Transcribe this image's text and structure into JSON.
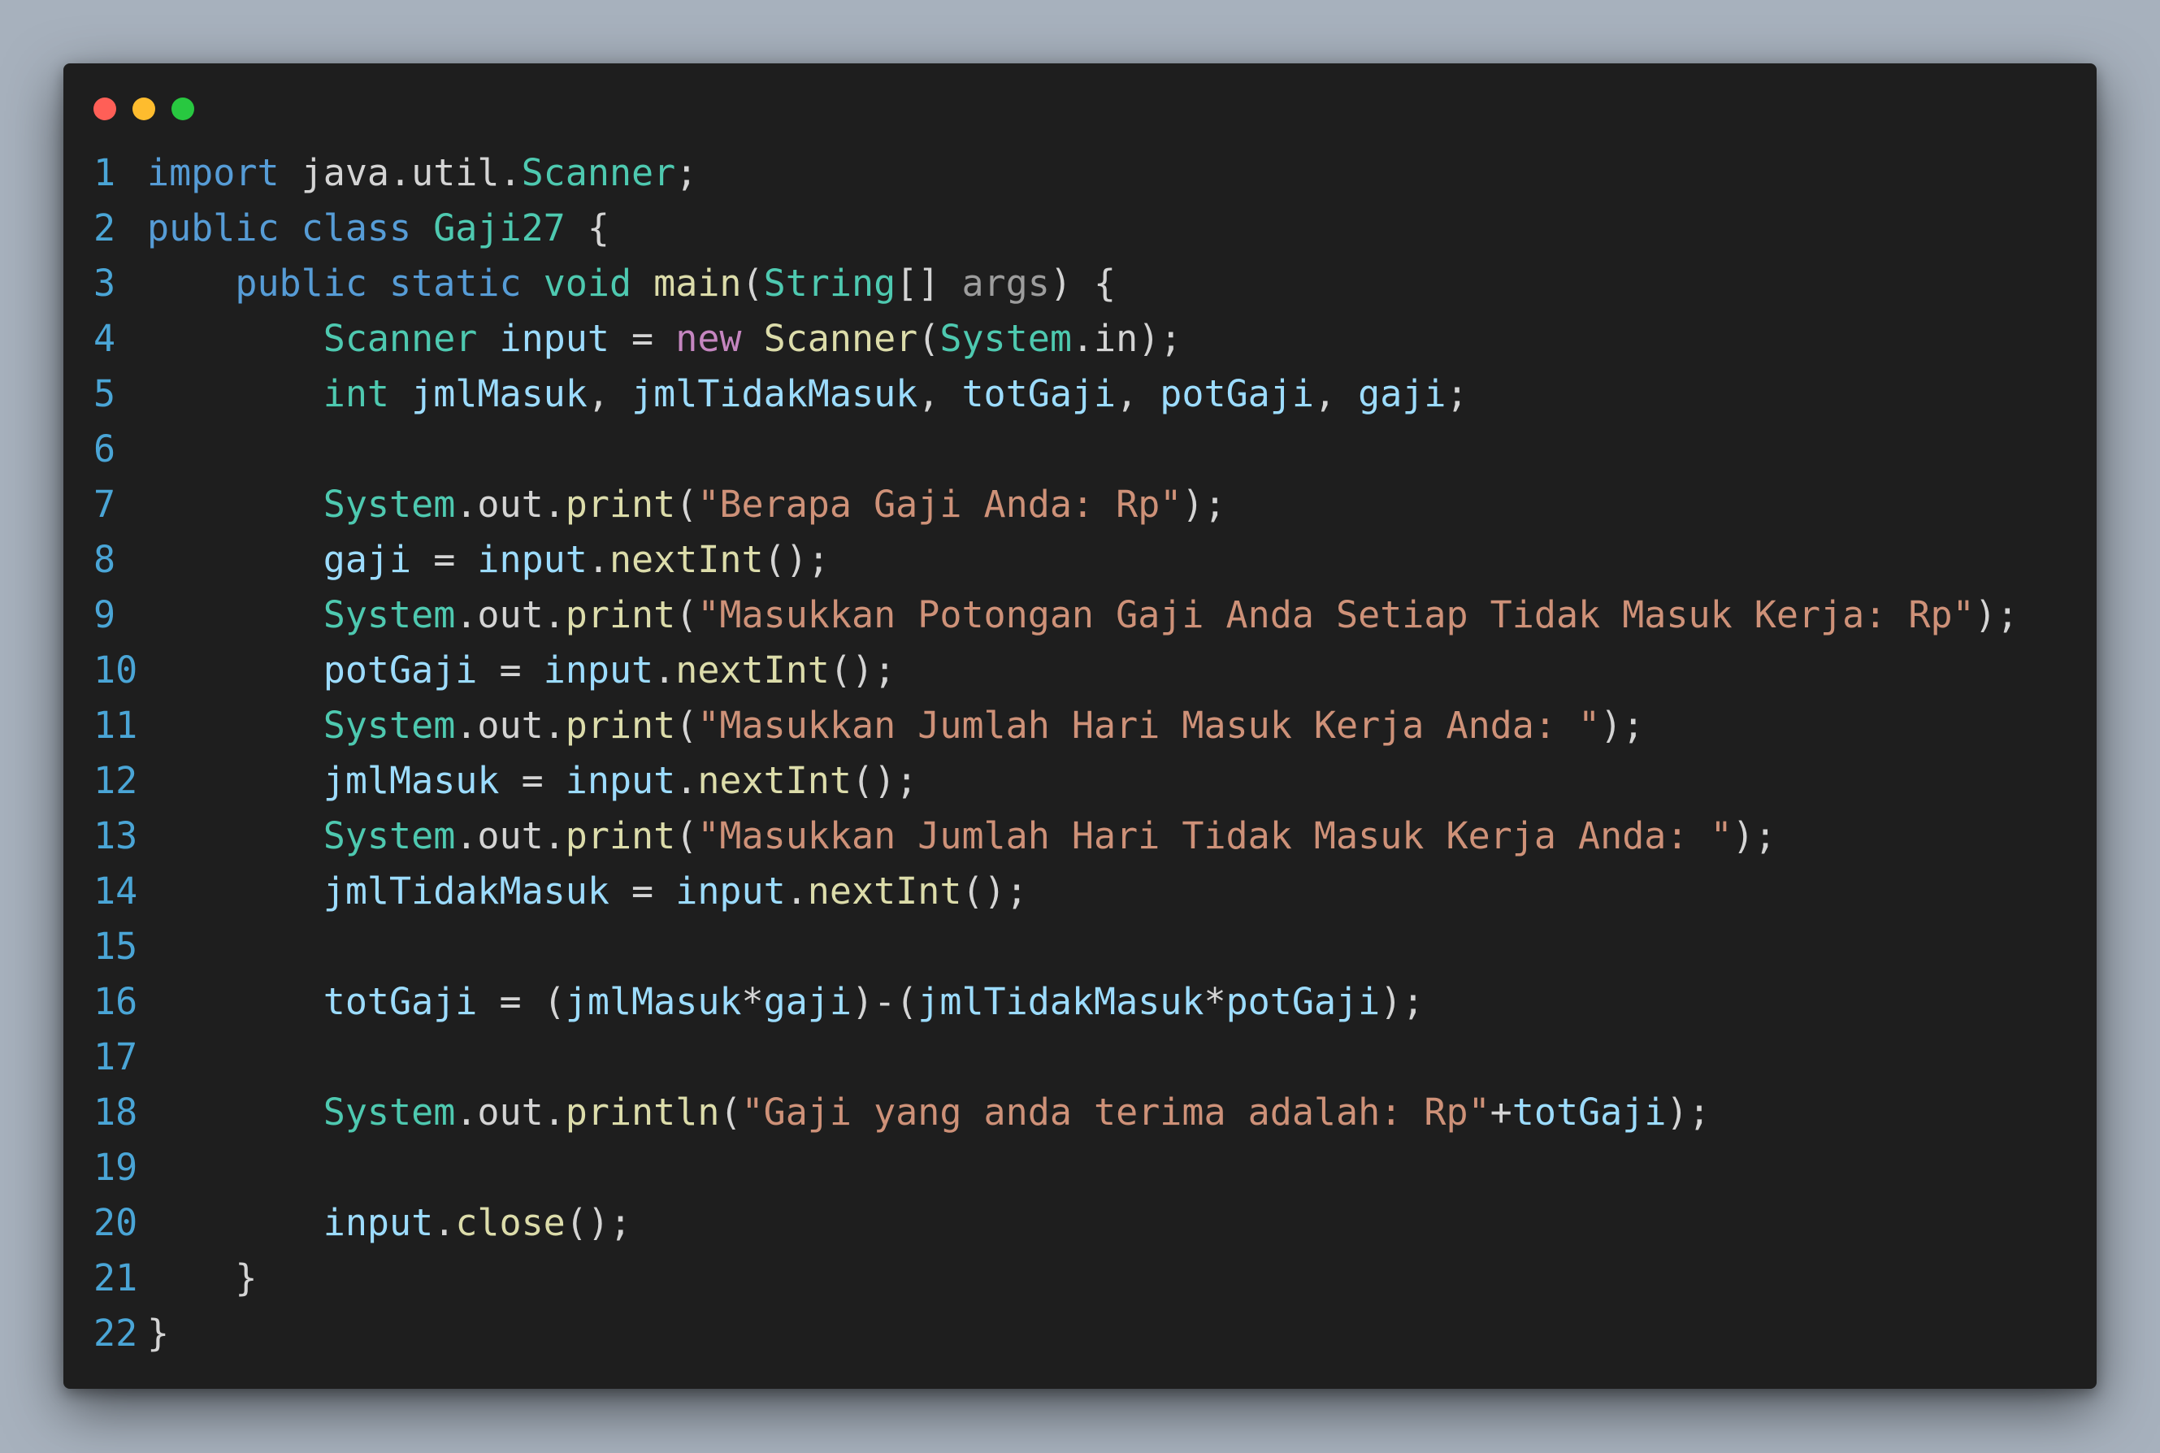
{
  "window": {
    "buttons": [
      {
        "name": "close",
        "color": "#ff5f57"
      },
      {
        "name": "minimize",
        "color": "#febc2e"
      },
      {
        "name": "maximize",
        "color": "#28c840"
      }
    ]
  },
  "colors": {
    "background": "#a7b1bd",
    "editor_bg": "#1e1e1e",
    "line_number": "#4aa5d6",
    "keyword": "#569cd6",
    "type": "#4ec9b0",
    "function": "#dcdcaa",
    "variable": "#9cdcfe",
    "string": "#ce9178",
    "new_keyword": "#c586c0",
    "plain": "#d4d4d4"
  },
  "code": {
    "language": "java",
    "lines": [
      {
        "n": "1",
        "indent": "",
        "tokens": [
          {
            "t": "import",
            "c": "kw"
          },
          {
            "t": " java.util.",
            "c": "pl"
          },
          {
            "t": "Scanner",
            "c": "ty"
          },
          {
            "t": ";",
            "c": "pl"
          }
        ]
      },
      {
        "n": "2",
        "indent": "",
        "tokens": [
          {
            "t": "public",
            "c": "kw"
          },
          {
            "t": " ",
            "c": "pl"
          },
          {
            "t": "class",
            "c": "kw"
          },
          {
            "t": " ",
            "c": "pl"
          },
          {
            "t": "Gaji27",
            "c": "ty"
          },
          {
            "t": " {",
            "c": "pl"
          }
        ]
      },
      {
        "n": "3",
        "indent": "    ",
        "tokens": [
          {
            "t": "public",
            "c": "kw"
          },
          {
            "t": " ",
            "c": "pl"
          },
          {
            "t": "static",
            "c": "kw"
          },
          {
            "t": " ",
            "c": "pl"
          },
          {
            "t": "void",
            "c": "ty"
          },
          {
            "t": " ",
            "c": "pl"
          },
          {
            "t": "main",
            "c": "fn"
          },
          {
            "t": "(",
            "c": "pl"
          },
          {
            "t": "String",
            "c": "ty"
          },
          {
            "t": "[] ",
            "c": "pl"
          },
          {
            "t": "args",
            "c": "pm"
          },
          {
            "t": ") {",
            "c": "pl"
          }
        ]
      },
      {
        "n": "4",
        "indent": "        ",
        "tokens": [
          {
            "t": "Scanner",
            "c": "ty"
          },
          {
            "t": " ",
            "c": "pl"
          },
          {
            "t": "input",
            "c": "vr"
          },
          {
            "t": " = ",
            "c": "pl"
          },
          {
            "t": "new",
            "c": "nw"
          },
          {
            "t": " ",
            "c": "pl"
          },
          {
            "t": "Scanner",
            "c": "fn"
          },
          {
            "t": "(",
            "c": "pl"
          },
          {
            "t": "System",
            "c": "ty"
          },
          {
            "t": ".in);",
            "c": "pl"
          }
        ]
      },
      {
        "n": "5",
        "indent": "        ",
        "tokens": [
          {
            "t": "int",
            "c": "ty"
          },
          {
            "t": " ",
            "c": "pl"
          },
          {
            "t": "jmlMasuk",
            "c": "vr"
          },
          {
            "t": ", ",
            "c": "pl"
          },
          {
            "t": "jmlTidakMasuk",
            "c": "vr"
          },
          {
            "t": ", ",
            "c": "pl"
          },
          {
            "t": "totGaji",
            "c": "vr"
          },
          {
            "t": ", ",
            "c": "pl"
          },
          {
            "t": "potGaji",
            "c": "vr"
          },
          {
            "t": ", ",
            "c": "pl"
          },
          {
            "t": "gaji",
            "c": "vr"
          },
          {
            "t": ";",
            "c": "pl"
          }
        ]
      },
      {
        "n": "6",
        "indent": "",
        "tokens": []
      },
      {
        "n": "7",
        "indent": "        ",
        "tokens": [
          {
            "t": "System",
            "c": "ty"
          },
          {
            "t": ".out.",
            "c": "pl"
          },
          {
            "t": "print",
            "c": "fn"
          },
          {
            "t": "(",
            "c": "pl"
          },
          {
            "t": "\"Berapa Gaji Anda: Rp\"",
            "c": "st"
          },
          {
            "t": ");",
            "c": "pl"
          }
        ]
      },
      {
        "n": "8",
        "indent": "        ",
        "tokens": [
          {
            "t": "gaji",
            "c": "vr"
          },
          {
            "t": " = ",
            "c": "pl"
          },
          {
            "t": "input",
            "c": "vr"
          },
          {
            "t": ".",
            "c": "pl"
          },
          {
            "t": "nextInt",
            "c": "fn"
          },
          {
            "t": "();",
            "c": "pl"
          }
        ]
      },
      {
        "n": "9",
        "indent": "        ",
        "tokens": [
          {
            "t": "System",
            "c": "ty"
          },
          {
            "t": ".out.",
            "c": "pl"
          },
          {
            "t": "print",
            "c": "fn"
          },
          {
            "t": "(",
            "c": "pl"
          },
          {
            "t": "\"Masukkan Potongan Gaji Anda Setiap Tidak Masuk Kerja: Rp\"",
            "c": "st"
          },
          {
            "t": ");",
            "c": "pl"
          }
        ]
      },
      {
        "n": "10",
        "indent": "        ",
        "tokens": [
          {
            "t": "potGaji",
            "c": "vr"
          },
          {
            "t": " = ",
            "c": "pl"
          },
          {
            "t": "input",
            "c": "vr"
          },
          {
            "t": ".",
            "c": "pl"
          },
          {
            "t": "nextInt",
            "c": "fn"
          },
          {
            "t": "();",
            "c": "pl"
          }
        ]
      },
      {
        "n": "11",
        "indent": "        ",
        "tokens": [
          {
            "t": "System",
            "c": "ty"
          },
          {
            "t": ".out.",
            "c": "pl"
          },
          {
            "t": "print",
            "c": "fn"
          },
          {
            "t": "(",
            "c": "pl"
          },
          {
            "t": "\"Masukkan Jumlah Hari Masuk Kerja Anda: \"",
            "c": "st"
          },
          {
            "t": ");",
            "c": "pl"
          }
        ]
      },
      {
        "n": "12",
        "indent": "        ",
        "tokens": [
          {
            "t": "jmlMasuk",
            "c": "vr"
          },
          {
            "t": " = ",
            "c": "pl"
          },
          {
            "t": "input",
            "c": "vr"
          },
          {
            "t": ".",
            "c": "pl"
          },
          {
            "t": "nextInt",
            "c": "fn"
          },
          {
            "t": "();",
            "c": "pl"
          }
        ]
      },
      {
        "n": "13",
        "indent": "        ",
        "tokens": [
          {
            "t": "System",
            "c": "ty"
          },
          {
            "t": ".out.",
            "c": "pl"
          },
          {
            "t": "print",
            "c": "fn"
          },
          {
            "t": "(",
            "c": "pl"
          },
          {
            "t": "\"Masukkan Jumlah Hari Tidak Masuk Kerja Anda: \"",
            "c": "st"
          },
          {
            "t": ");",
            "c": "pl"
          }
        ]
      },
      {
        "n": "14",
        "indent": "        ",
        "tokens": [
          {
            "t": "jmlTidakMasuk",
            "c": "vr"
          },
          {
            "t": " = ",
            "c": "pl"
          },
          {
            "t": "input",
            "c": "vr"
          },
          {
            "t": ".",
            "c": "pl"
          },
          {
            "t": "nextInt",
            "c": "fn"
          },
          {
            "t": "();",
            "c": "pl"
          }
        ]
      },
      {
        "n": "15",
        "indent": "",
        "tokens": []
      },
      {
        "n": "16",
        "indent": "        ",
        "tokens": [
          {
            "t": "totGaji",
            "c": "vr"
          },
          {
            "t": " = (",
            "c": "pl"
          },
          {
            "t": "jmlMasuk",
            "c": "vr"
          },
          {
            "t": "*",
            "c": "pl"
          },
          {
            "t": "gaji",
            "c": "vr"
          },
          {
            "t": ")-(",
            "c": "pl"
          },
          {
            "t": "jmlTidakMasuk",
            "c": "vr"
          },
          {
            "t": "*",
            "c": "pl"
          },
          {
            "t": "potGaji",
            "c": "vr"
          },
          {
            "t": ");",
            "c": "pl"
          }
        ]
      },
      {
        "n": "17",
        "indent": "",
        "tokens": []
      },
      {
        "n": "18",
        "indent": "        ",
        "tokens": [
          {
            "t": "System",
            "c": "ty"
          },
          {
            "t": ".out.",
            "c": "pl"
          },
          {
            "t": "println",
            "c": "fn"
          },
          {
            "t": "(",
            "c": "pl"
          },
          {
            "t": "\"Gaji yang anda terima adalah: Rp\"",
            "c": "st"
          },
          {
            "t": "+",
            "c": "pl"
          },
          {
            "t": "totGaji",
            "c": "vr"
          },
          {
            "t": ");",
            "c": "pl"
          }
        ]
      },
      {
        "n": "19",
        "indent": "",
        "tokens": []
      },
      {
        "n": "20",
        "indent": "        ",
        "tokens": [
          {
            "t": "input",
            "c": "vr"
          },
          {
            "t": ".",
            "c": "pl"
          },
          {
            "t": "close",
            "c": "fn"
          },
          {
            "t": "();",
            "c": "pl"
          }
        ]
      },
      {
        "n": "21",
        "indent": "    ",
        "tokens": [
          {
            "t": "}",
            "c": "pl"
          }
        ]
      },
      {
        "n": "22",
        "indent": "",
        "tokens": [
          {
            "t": "}",
            "c": "pl"
          }
        ]
      }
    ]
  }
}
